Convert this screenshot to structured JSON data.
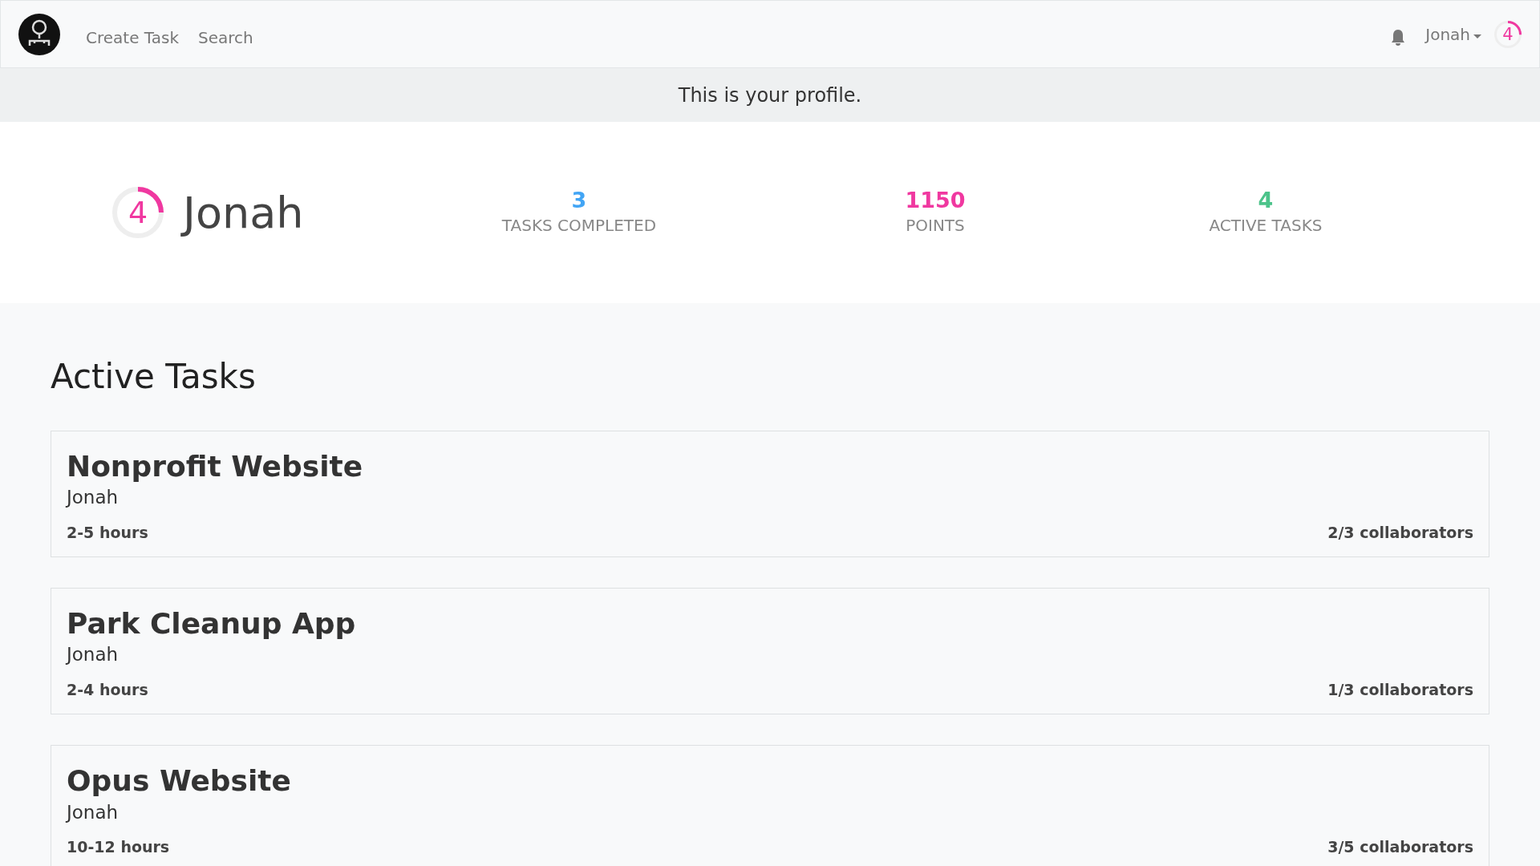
{
  "navbar": {
    "links": [
      "Create Task",
      "Search"
    ],
    "user": "Jonah",
    "level": {
      "label": "4",
      "level": 0.25
    }
  },
  "banner": "This is your profile.",
  "profile": {
    "level": {
      "label": "4",
      "level": 0.25
    },
    "name": "Jonah",
    "stats": [
      {
        "value": "3",
        "label": "TASKS COMPLETED",
        "color": "#42a5f5"
      },
      {
        "value": "1150",
        "label": "POINTS",
        "color": "#f038a0"
      },
      {
        "value": "4",
        "label": "ACTIVE TASKS",
        "color": "#4cc38a"
      }
    ]
  },
  "active_tasks": {
    "heading": "Active Tasks",
    "tasks": [
      {
        "title": "Nonprofit Website",
        "owner": "Jonah",
        "hours": "2-5 hours",
        "collaborators": "2/3 collaborators"
      },
      {
        "title": "Park Cleanup App",
        "owner": "Jonah",
        "hours": "2-4 hours",
        "collaborators": "1/3 collaborators"
      },
      {
        "title": "Opus Website",
        "owner": "Jonah",
        "hours": "10-12 hours",
        "collaborators": "3/5 collaborators"
      }
    ]
  }
}
